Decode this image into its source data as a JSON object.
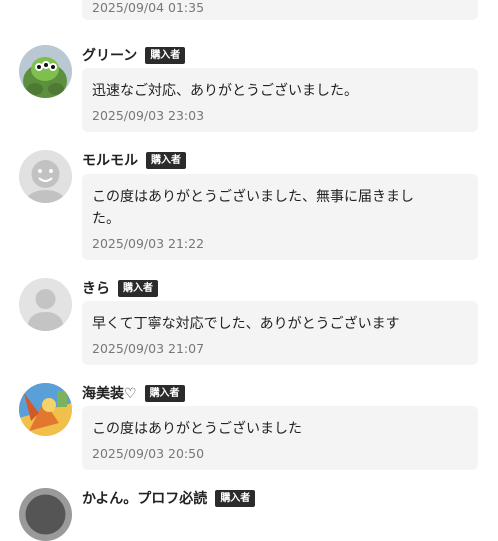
{
  "previous_review": {
    "date": "2025/09/04 01:35"
  },
  "reviews": [
    {
      "name": "グリーン",
      "badge": "購入者",
      "comment": "迅速なご対応、ありがとうございました。",
      "date": "2025/09/03 23:03",
      "avatar_icon": "alien-toy-avatar"
    },
    {
      "name": "モルモル",
      "badge": "購入者",
      "comment": "この度はありがとうございました、無事に届きました。",
      "date": "2025/09/03 21:22",
      "avatar_icon": "smiley-face-avatar"
    },
    {
      "name": "きら",
      "badge": "購入者",
      "comment": "早くて丁寧な対応でした、ありがとうございます",
      "date": "2025/09/03 21:07",
      "avatar_icon": "default-person-avatar"
    },
    {
      "name": "海美装♡",
      "badge": "購入者",
      "comment": "この度はありがとうございました",
      "date": "2025/09/03 20:50",
      "avatar_icon": "card-art-avatar"
    },
    {
      "name": "かよん。プロフ必読",
      "badge": "購入者",
      "avatar_icon": "photo-avatar"
    }
  ],
  "colors": {
    "badge_bg": "#2b2b2b",
    "bubble_bg": "#f4f4f4",
    "date_text": "#777777"
  }
}
